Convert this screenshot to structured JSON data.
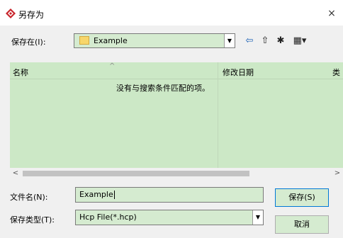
{
  "window": {
    "title": "另存为",
    "close_glyph": "×"
  },
  "save_in": {
    "label": "保存在(I):",
    "value": "Example"
  },
  "toolbar": {
    "back_glyph": "⇦",
    "up_glyph": "⇧",
    "new_folder_glyph": "✱",
    "view_glyph": "▦▾"
  },
  "file_list": {
    "columns": [
      "名称",
      "修改日期",
      "类"
    ],
    "empty_message": "没有与搜索条件匹配的项。"
  },
  "filename": {
    "label": "文件名(N):",
    "value": "Example"
  },
  "filetype": {
    "label": "保存类型(T):",
    "value": "Hcp File(*.hcp)"
  },
  "buttons": {
    "save": "保存(S)",
    "cancel": "取消"
  },
  "colors": {
    "selection_green": "#cce8c6",
    "field_green": "#d5ebd0",
    "icon_red": "#c8242b"
  }
}
